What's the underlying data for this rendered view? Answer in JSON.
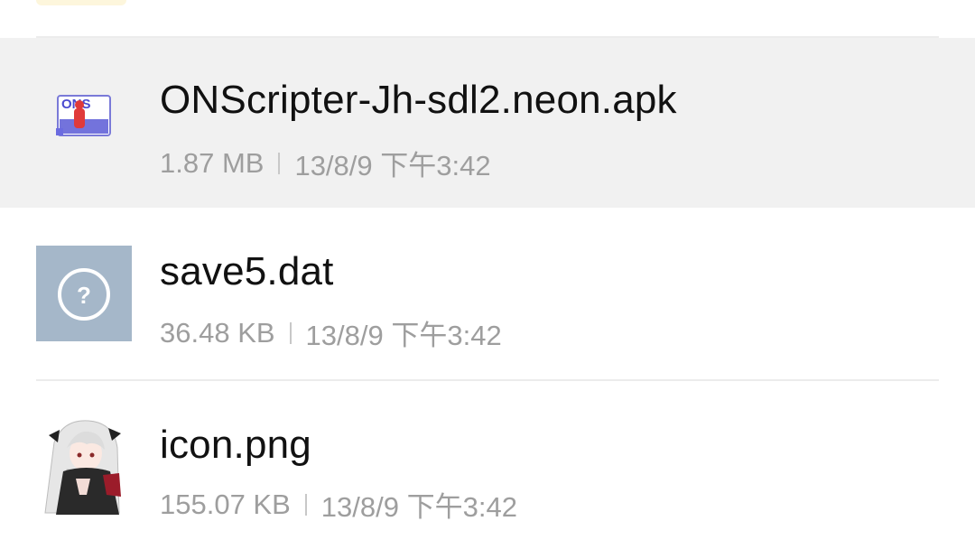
{
  "files": [
    {
      "name": "ONScripter-Jh-sdl2.neon.apk",
      "size": "1.87 MB",
      "date": "13/8/9 下午3:42",
      "icon": "apk-icon",
      "selected": true
    },
    {
      "name": "save5.dat",
      "size": "36.48 KB",
      "date": "13/8/9 下午3:42",
      "icon": "unknown-file-icon",
      "selected": false
    },
    {
      "name": "icon.png",
      "size": "155.07 KB",
      "date": "13/8/9 下午3:42",
      "icon": "image-thumbnail-icon",
      "selected": false
    }
  ],
  "apk_icon_text": "ONS",
  "colors": {
    "selected_row": "#f1f1f1",
    "unknown_tile": "#a5b7c9",
    "meta_text": "#9e9e9e",
    "name_text": "#111111"
  }
}
